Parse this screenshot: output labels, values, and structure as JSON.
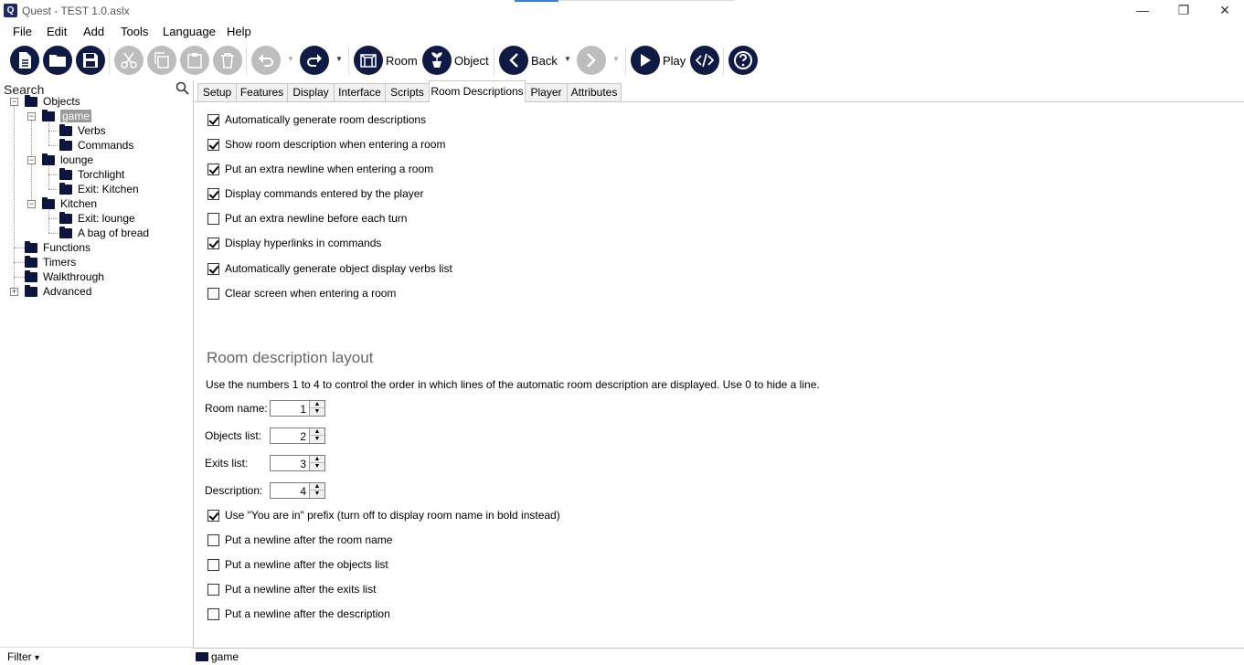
{
  "window": {
    "title": "Quest - TEST 1.0.aslx",
    "app_icon": "quest-logo-icon",
    "minimize": "—",
    "restore": "❐",
    "close": "✕"
  },
  "menu": [
    "File",
    "Edit",
    "Add",
    "Tools",
    "Language",
    "Help"
  ],
  "toolbar": {
    "new_icon": "new-file-icon",
    "open_icon": "open-folder-icon",
    "save_icon": "save-disk-icon",
    "cut_icon": "cut-scissors-icon",
    "copy_icon": "copy-icon",
    "paste_icon": "paste-clipboard-icon",
    "delete_icon": "delete-trash-icon",
    "undo_icon": "undo-icon",
    "redo_icon": "redo-icon",
    "room_label": "Room",
    "object_label": "Object",
    "back_label": "Back",
    "play_label": "Play",
    "code_icon": "code-view-icon",
    "help_icon": "help-icon"
  },
  "search": {
    "label": "Search"
  },
  "tree": {
    "objects": "Objects",
    "game": "game",
    "verbs": "Verbs",
    "commands": "Commands",
    "lounge": "lounge",
    "torchlight": "Torchlight",
    "exit_kitchen": "Exit: Kitchen",
    "kitchen": "Kitchen",
    "exit_lounge": "Exit: lounge",
    "bread": "A bag of bread",
    "functions": "Functions",
    "timers": "Timers",
    "walkthrough": "Walkthrough",
    "advanced": "Advanced"
  },
  "filter": {
    "label": "Filter",
    "arrow": "▾"
  },
  "tabs": [
    "Setup",
    "Features",
    "Display",
    "Interface",
    "Scripts",
    "Room Descriptions",
    "Player",
    "Attributes"
  ],
  "active_tab": "Room Descriptions",
  "options": [
    {
      "label": "Automatically generate room descriptions",
      "checked": true
    },
    {
      "label": "Show room description when entering a room",
      "checked": true
    },
    {
      "label": "Put an extra newline when entering a room",
      "checked": true
    },
    {
      "label": "Display commands entered by the player",
      "checked": true
    },
    {
      "label": "Put an extra newline before each turn",
      "checked": false
    },
    {
      "label": "Display hyperlinks in commands",
      "checked": true
    },
    {
      "label": "Automatically generate object display verbs list",
      "checked": true
    },
    {
      "label": "Clear screen when entering a room",
      "checked": false
    }
  ],
  "layout_section": {
    "heading": "Room description layout",
    "help": "Use the numbers 1 to 4 to control the order in which lines of the automatic room description are displayed. Use 0 to hide a line.",
    "fields": [
      {
        "label": "Room name:",
        "value": "1"
      },
      {
        "label": "Objects list:",
        "value": "2"
      },
      {
        "label": "Exits list:",
        "value": "3"
      },
      {
        "label": "Description:",
        "value": "4"
      }
    ]
  },
  "layout_options": [
    {
      "label": "Use \"You are in\" prefix (turn off to display room name in bold instead)",
      "checked": true
    },
    {
      "label": "Put a newline after the room name",
      "checked": false
    },
    {
      "label": "Put a newline after the objects list",
      "checked": false
    },
    {
      "label": "Put a newline after the exits list",
      "checked": false
    },
    {
      "label": "Put a newline after the description",
      "checked": false
    }
  ],
  "status": {
    "current": "game"
  }
}
